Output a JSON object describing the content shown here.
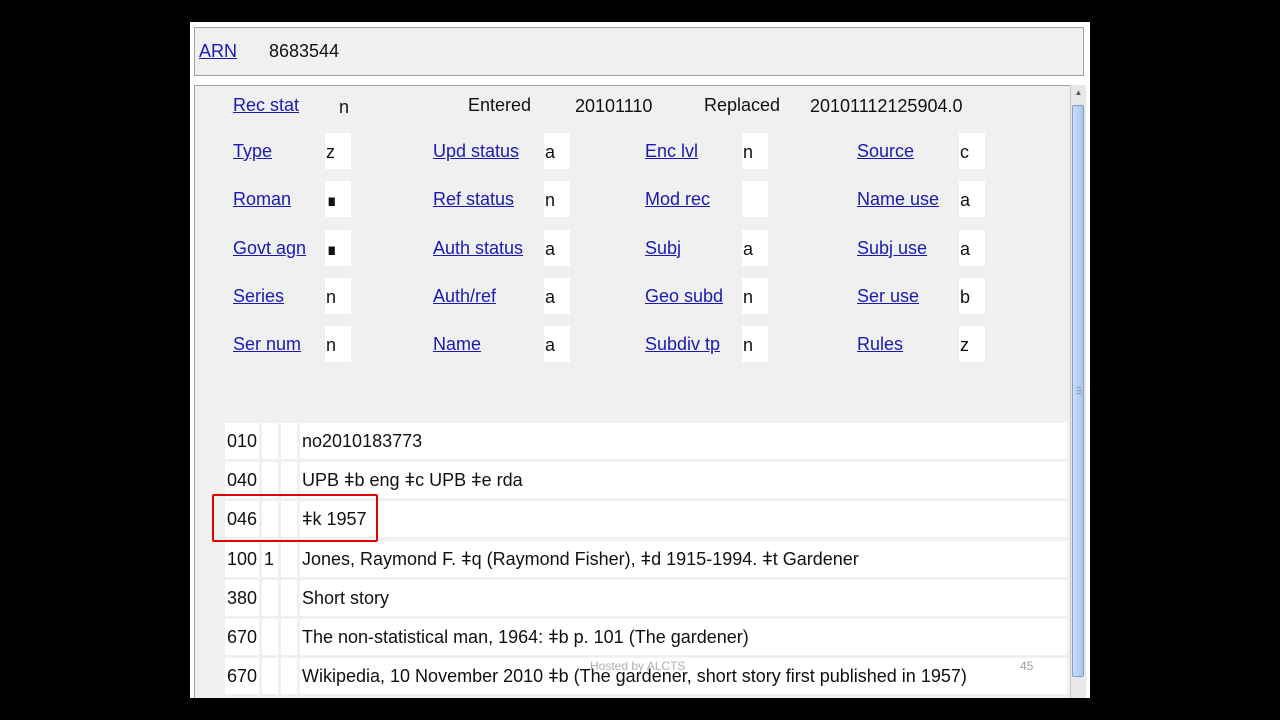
{
  "arn": {
    "label": "ARN",
    "value": "8683544"
  },
  "header_fields": {
    "rec_stat": {
      "label": "Rec stat",
      "value": "n"
    },
    "entered": {
      "label": "Entered",
      "value": "20101110"
    },
    "replaced": {
      "label": "Replaced",
      "value": "20101112125904.0"
    }
  },
  "fixed_fields": [
    [
      {
        "label": "Type",
        "value": "z"
      },
      {
        "label": "Upd status",
        "value": "a"
      },
      {
        "label": "Enc lvl",
        "value": "n"
      },
      {
        "label": "Source",
        "value": "c"
      }
    ],
    [
      {
        "label": "Roman",
        "value": "∎"
      },
      {
        "label": "Ref status",
        "value": "n"
      },
      {
        "label": "Mod rec",
        "value": ""
      },
      {
        "label": "Name use",
        "value": "a"
      }
    ],
    [
      {
        "label": "Govt agn",
        "value": "∎"
      },
      {
        "label": "Auth status",
        "value": "a"
      },
      {
        "label": "Subj",
        "value": "a"
      },
      {
        "label": "Subj use",
        "value": "a"
      }
    ],
    [
      {
        "label": "Series",
        "value": "n"
      },
      {
        "label": "Auth/ref",
        "value": "a"
      },
      {
        "label": "Geo subd",
        "value": "n"
      },
      {
        "label": "Ser use",
        "value": "b"
      }
    ],
    [
      {
        "label": "Ser num",
        "value": "n"
      },
      {
        "label": "Name",
        "value": "a"
      },
      {
        "label": "Subdiv tp",
        "value": "n"
      },
      {
        "label": "Rules",
        "value": "z"
      }
    ]
  ],
  "variable_fields": [
    {
      "tag": "010",
      "ind1": "",
      "ind2": "",
      "content": "no2010183773"
    },
    {
      "tag": "040",
      "ind1": "",
      "ind2": "",
      "content": "UPB ǂb eng ǂc UPB ǂe rda"
    },
    {
      "tag": "046",
      "ind1": "",
      "ind2": "",
      "content": "ǂk 1957"
    },
    {
      "tag": "100",
      "ind1": "1",
      "ind2": "",
      "content": "Jones, Raymond F. ǂq (Raymond Fisher), ǂd 1915-1994. ǂt Gardener"
    },
    {
      "tag": "380",
      "ind1": "",
      "ind2": "",
      "content": "Short story"
    },
    {
      "tag": "670",
      "ind1": "",
      "ind2": "",
      "content": "The non-statistical man, 1964: ǂb p. 101 (The gardener)"
    },
    {
      "tag": "670",
      "ind1": "",
      "ind2": "",
      "content": "Wikipedia, 10 November 2010 ǂb (The gardener, short story first published in 1957)"
    }
  ],
  "highlight": {
    "field_tag": "046",
    "color": "#e00000"
  },
  "footer": {
    "text": "Hosted by ALCTS",
    "page_number": "45"
  },
  "colors": {
    "link": "#1a1ab0",
    "background": "#000000",
    "pane": "#f0f0f0"
  }
}
